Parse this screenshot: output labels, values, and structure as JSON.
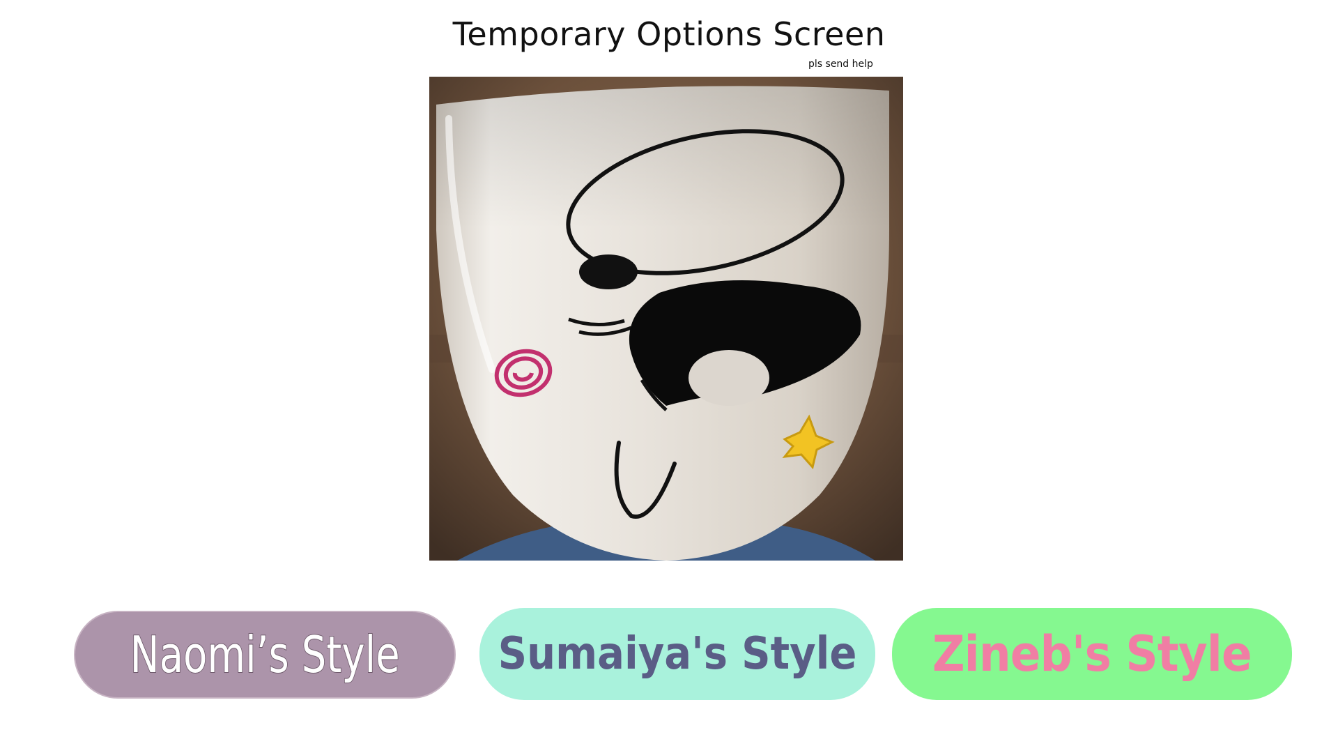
{
  "title": "Temporary Options Screen",
  "subtitle": "pls send help",
  "image": {
    "icon": "mug-face-image"
  },
  "buttons": [
    {
      "label": "Naomi’s Style",
      "bg": "#ac94aa",
      "fg": "#ffffff"
    },
    {
      "label": "Sumaiya's Style",
      "bg": "#a9f2dc",
      "fg": "#5a5d86"
    },
    {
      "label": "Zineb's Style",
      "bg": "#85f890",
      "fg": "#f07ea4"
    }
  ]
}
